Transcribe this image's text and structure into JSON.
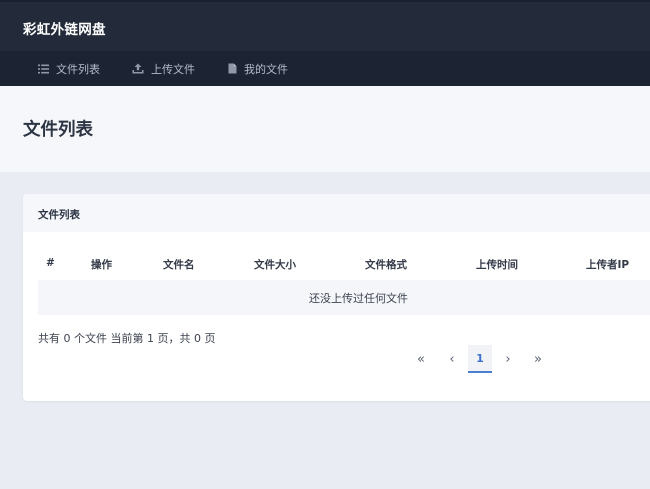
{
  "app": {
    "brand": "彩虹外链网盘"
  },
  "nav": {
    "items": [
      {
        "label": "文件列表",
        "icon": "list-icon"
      },
      {
        "label": "上传文件",
        "icon": "upload-icon"
      },
      {
        "label": "我的文件",
        "icon": "file-icon"
      }
    ]
  },
  "page": {
    "title": "文件列表"
  },
  "card": {
    "title": "文件列表",
    "columns": [
      "#",
      "操作",
      "文件名",
      "文件大小",
      "文件格式",
      "上传时间",
      "上传者IP"
    ],
    "empty_text": "还没上传过任何文件",
    "summary": "共有 0 个文件  当前第 1 页，共 0 页"
  },
  "pagination": {
    "first": "«",
    "prev": "‹",
    "current": "1",
    "next": "›",
    "last": "»"
  },
  "colors": {
    "topbar": "#232b3b",
    "navbar": "#1c2333",
    "accent": "#4a7fd0",
    "background": "#e9ecf2"
  }
}
